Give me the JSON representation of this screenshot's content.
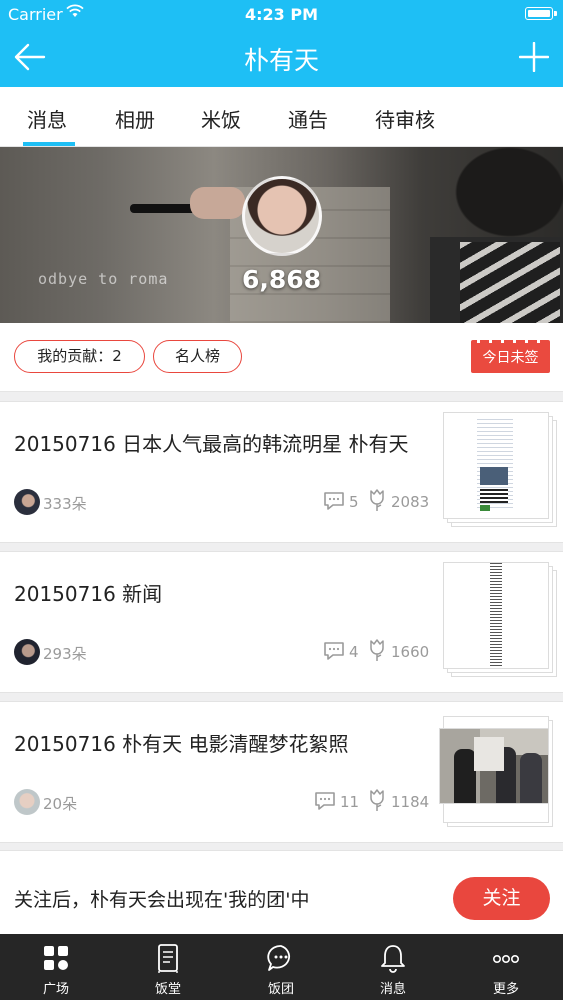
{
  "status_bar": {
    "carrier": "Carrier",
    "time": "4:23 PM"
  },
  "nav": {
    "title": "朴有天",
    "back_icon": "back-arrow-icon",
    "add_icon": "plus-icon"
  },
  "tabs": [
    {
      "label": "消息",
      "active": true
    },
    {
      "label": "相册",
      "active": false
    },
    {
      "label": "米饭",
      "active": false
    },
    {
      "label": "通告",
      "active": false
    },
    {
      "label": "待审核",
      "active": false
    }
  ],
  "banner": {
    "overlay_text": "odbye to roma",
    "count": "6,868"
  },
  "contribution": {
    "my_contribution": "我的贡献：2",
    "leaderboard": "名人榜",
    "checkin": "今日未签"
  },
  "posts": [
    {
      "title": "20150716 日本人气最高的韩流明星 朴有天",
      "flowers": "333朵",
      "comments": "5",
      "likes": "2083",
      "thumb": "document"
    },
    {
      "title": "20150716 新闻",
      "flowers": "293朵",
      "comments": "4",
      "likes": "1660",
      "thumb": "narrow-document"
    },
    {
      "title": "20150716 朴有天 电影清醒梦花絮照",
      "flowers": "20朵",
      "comments": "11",
      "likes": "1184",
      "thumb": "photo"
    }
  ],
  "follow": {
    "text": "关注后，朴有天会出现在'我的团'中",
    "button": "关注"
  },
  "bottom_tabs": [
    {
      "label": "广场",
      "icon": "grid-icon"
    },
    {
      "label": "饭堂",
      "icon": "notebook-icon"
    },
    {
      "label": "饭团",
      "icon": "chat-bubble-icon"
    },
    {
      "label": "消息",
      "icon": "bell-icon"
    },
    {
      "label": "更多",
      "icon": "more-dots-icon"
    }
  ],
  "colors": {
    "brand": "#1ebff5",
    "accent_red": "#e9473e",
    "tab_bar": "#262626"
  }
}
